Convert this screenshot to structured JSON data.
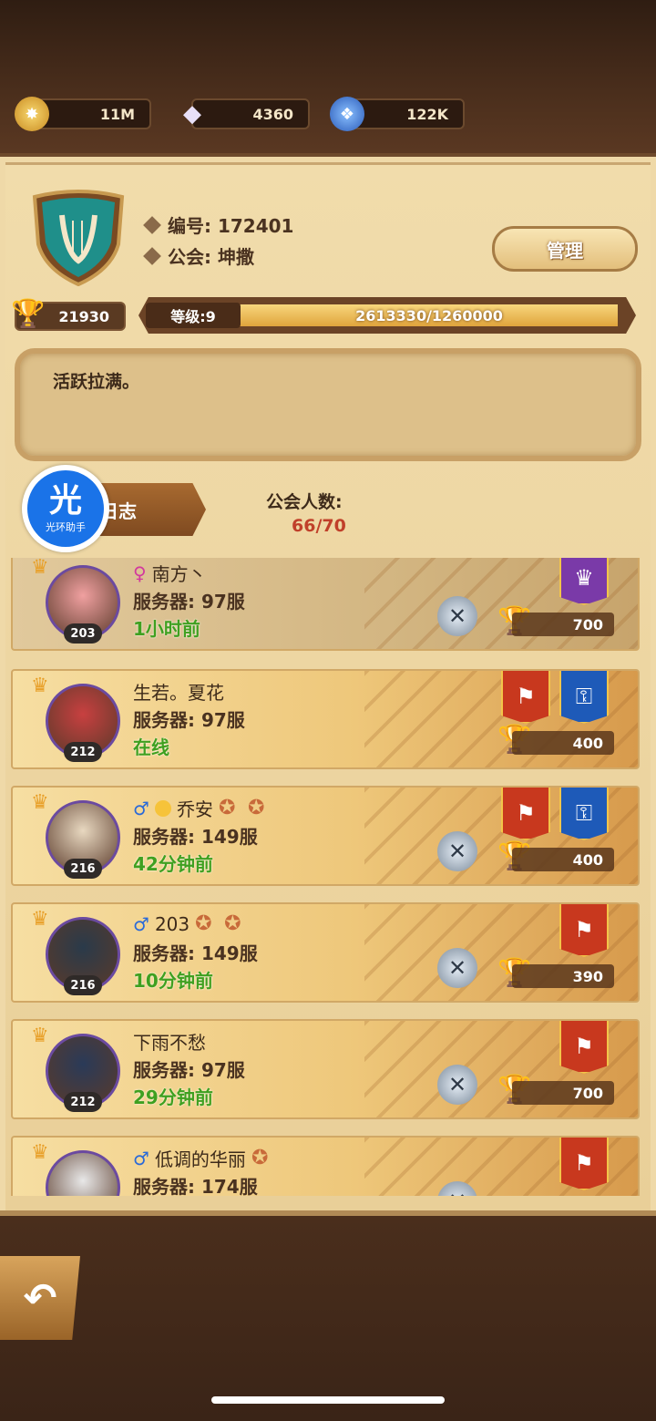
{
  "resources": [
    {
      "icon": "gold-coin-icon",
      "value": "11M"
    },
    {
      "icon": "diamond-icon",
      "value": "4360"
    },
    {
      "icon": "blue-crystal-icon",
      "value": "122K"
    }
  ],
  "guild": {
    "id_line": "编号: 172401",
    "name_line": "公会: 坤撒",
    "manage_label": "管理",
    "trophy_score": "21930",
    "level_label": "等级:9",
    "exp_text": "2613330/1260000",
    "exp_fraction": 1.0,
    "notice": "活跃拉满。",
    "log_label": "日志",
    "member_count_label": "公会人数:",
    "member_count_value": "66/70"
  },
  "assistant": {
    "char": "光",
    "label": "光环助手"
  },
  "members": [
    {
      "gender": "♀",
      "gender_type": "f",
      "name": "南方丶",
      "server": "服务器: 97服",
      "status": "1小时前",
      "level": "203",
      "score": "700",
      "banners": [
        "purple"
      ],
      "sword": true,
      "self": true
    },
    {
      "gender": "",
      "gender_type": "",
      "name": "生若。夏花",
      "server": "服务器: 97服",
      "status": "在线",
      "level": "212",
      "score": "400",
      "banners": [
        "red",
        "blue"
      ],
      "sword": false,
      "self": false
    },
    {
      "gender": "♂",
      "gender_type": "m",
      "name": "乔安",
      "server": "服务器: 149服",
      "status": "42分钟前",
      "level": "216",
      "score": "400",
      "banners": [
        "red",
        "blue"
      ],
      "sword": true,
      "self": false
    },
    {
      "gender": "♂",
      "gender_type": "m",
      "name": "203",
      "server": "服务器: 149服",
      "status": "10分钟前",
      "level": "216",
      "score": "390",
      "banners": [
        "red"
      ],
      "sword": true,
      "self": false
    },
    {
      "gender": "",
      "gender_type": "",
      "name": "下雨不愁",
      "server": "服务器: 97服",
      "status": "29分钟前",
      "level": "212",
      "score": "700",
      "banners": [
        "red"
      ],
      "sword": true,
      "self": false
    },
    {
      "gender": "♂",
      "gender_type": "m",
      "name": "低调的华丽",
      "server": "服务器: 174服",
      "status": "",
      "level": "",
      "score": "",
      "banners": [
        "red"
      ],
      "sword": true,
      "self": false
    }
  ]
}
